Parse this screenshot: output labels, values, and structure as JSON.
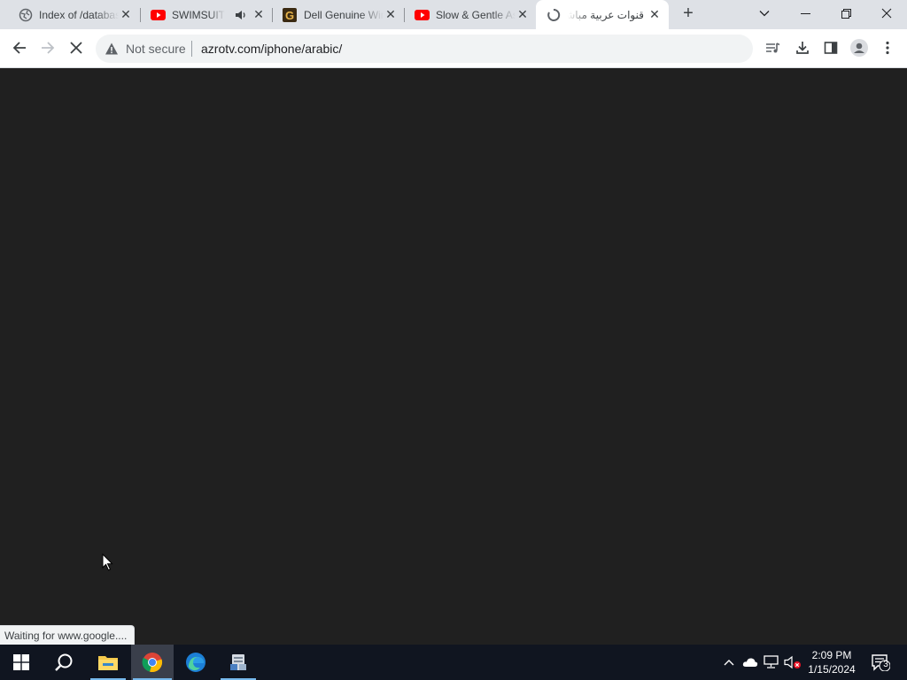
{
  "tabs": [
    {
      "title": "Index of /database",
      "icon": "globe-icon",
      "active": false
    },
    {
      "title": "SWIMSUIT",
      "icon": "youtube-icon",
      "active": false,
      "muted_icon": "speaker-icon"
    },
    {
      "title": "Dell Genuine Windows",
      "icon": "g-logo-icon",
      "active": false
    },
    {
      "title": "Slow & Gentle Asmr",
      "icon": "youtube-icon",
      "active": false
    },
    {
      "title": "قنوات عربية مباشر",
      "icon": "loading-spinner-icon",
      "active": true
    }
  ],
  "tab_close_glyph": "✕",
  "new_tab_glyph": "+",
  "window_controls": {
    "tab_search": "⌄",
    "minimize": "—",
    "restore": "❐",
    "close": "✕"
  },
  "toolbar": {
    "back": "←",
    "forward": "→",
    "stop": "✕",
    "not_secure_label": "Not secure",
    "url": "azrotv.com/iphone/arabic/"
  },
  "status_bar": {
    "text": "Waiting for www.google...."
  },
  "taskbar": {
    "clock_time": "2:09 PM",
    "clock_date": "1/15/2024",
    "notification_count": "3"
  },
  "colors": {
    "page_background": "#202020",
    "tab_strip": "#dee1e6",
    "taskbar": "#101520",
    "youtube_red": "#ff0000",
    "accent_blue": "#76b9ed"
  }
}
